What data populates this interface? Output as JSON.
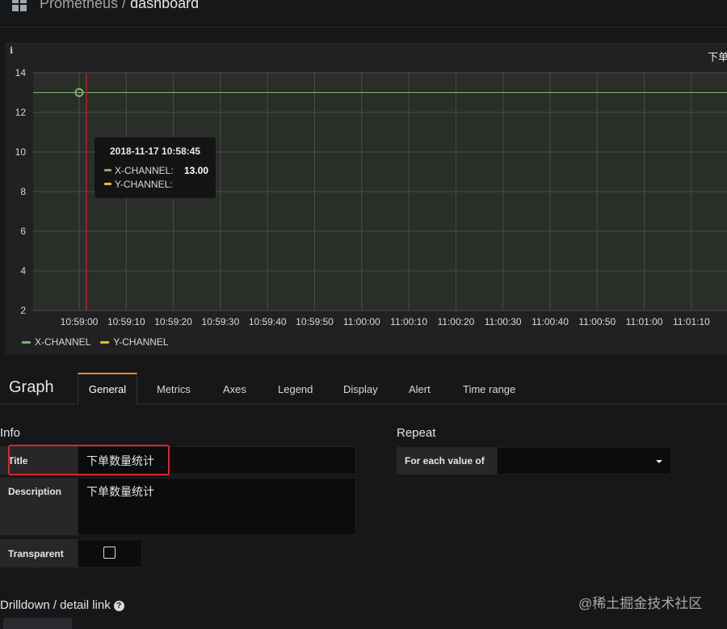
{
  "breadcrumb": {
    "parent": "Prometheus / ",
    "current": "dashboard"
  },
  "panel": {
    "info_icon": "i",
    "title": "下单"
  },
  "chart_data": {
    "type": "line",
    "y_ticks": [
      2,
      4,
      6,
      8,
      10,
      12,
      14
    ],
    "ylim": [
      2,
      14
    ],
    "x_ticks": [
      "10:59:00",
      "10:59:10",
      "10:59:20",
      "10:59:30",
      "10:59:40",
      "10:59:50",
      "11:00:00",
      "11:00:10",
      "11:00:20",
      "11:00:30",
      "11:00:40",
      "11:00:50",
      "11:01:00",
      "11:01:10"
    ],
    "series": [
      {
        "name": "X-CHANNEL",
        "color": "#7eb26d",
        "values": [
          13,
          13,
          13,
          13,
          13,
          13,
          13,
          13,
          13,
          13,
          13,
          13,
          13,
          13,
          13,
          13
        ]
      },
      {
        "name": "Y-CHANNEL",
        "color": "#eab839",
        "values": []
      }
    ],
    "cursor_time": "2018-11-17 10:58:45",
    "grid": true,
    "legend_position": "bottom-left"
  },
  "tooltip": {
    "time": "2018-11-17 10:58:45",
    "rows": [
      {
        "name": "X-CHANNEL:",
        "value": "13.00",
        "color": "#7eb26d"
      },
      {
        "name": "Y-CHANNEL:",
        "value": "",
        "color": "#eab839"
      }
    ]
  },
  "legend": [
    {
      "name": "X-CHANNEL",
      "color": "#7eb26d"
    },
    {
      "name": "Y-CHANNEL",
      "color": "#eab839"
    }
  ],
  "editor": {
    "title": "Graph",
    "tabs": [
      "General",
      "Metrics",
      "Axes",
      "Legend",
      "Display",
      "Alert",
      "Time range"
    ],
    "active_tab": "General"
  },
  "info": {
    "heading": "Info",
    "title_label": "Title",
    "title_value": "下单数量统计",
    "description_label": "Description",
    "description_value": "下单数量统计",
    "transparent_label": "Transparent",
    "transparent_checked": false
  },
  "repeat": {
    "heading": "Repeat",
    "for_each_label": "For each value of",
    "for_each_value": ""
  },
  "drilldown": {
    "heading": "Drilldown / detail link",
    "help_icon": "?"
  },
  "watermark": "@稀土掘金技术社区",
  "colors": {
    "accent": "#ee8524",
    "highlight_box": "#e02424",
    "background": "#161719",
    "panel": "#212124"
  }
}
